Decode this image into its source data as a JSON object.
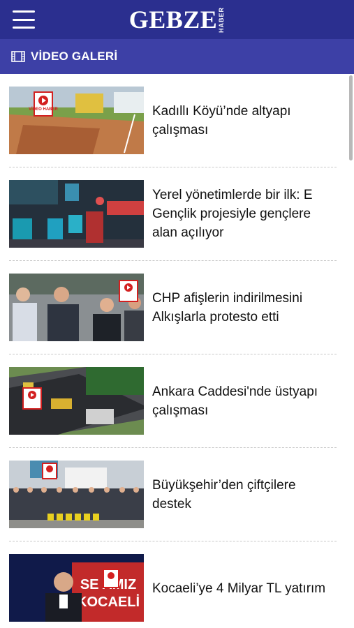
{
  "header": {
    "logo_text": "GEBZE",
    "logo_sub": "HABER",
    "menu_icon": "hamburger-menu-icon",
    "bg_color": "#2b2f8f"
  },
  "section": {
    "title": "VİDEO GALERİ",
    "icon": "film-icon",
    "bg_color": "#3d40a6"
  },
  "items": [
    {
      "title": "Kadıllı Köyü’nde altyapı çalışması",
      "badge": "VİDEO HABER"
    },
    {
      "title": "Yerel yönetimlerde bir ilk: E Gençlik projesiyle gençlere alan açılıyor",
      "badge": "VİDEO HABER"
    },
    {
      "title": "CHP afişlerin indirilmesini Alkışlarla protesto etti",
      "badge": "VİDEO HABER"
    },
    {
      "title": "Ankara Caddesi'nde üstyapı çalışması",
      "badge": "VİDEO HABER"
    },
    {
      "title": "Büyükşehir’den çiftçilere destek",
      "badge": "VİDEO HABER"
    },
    {
      "title": "Kocaeli’ye 4 Milyar TL yatırım",
      "badge": "VİDEO HABER"
    }
  ]
}
